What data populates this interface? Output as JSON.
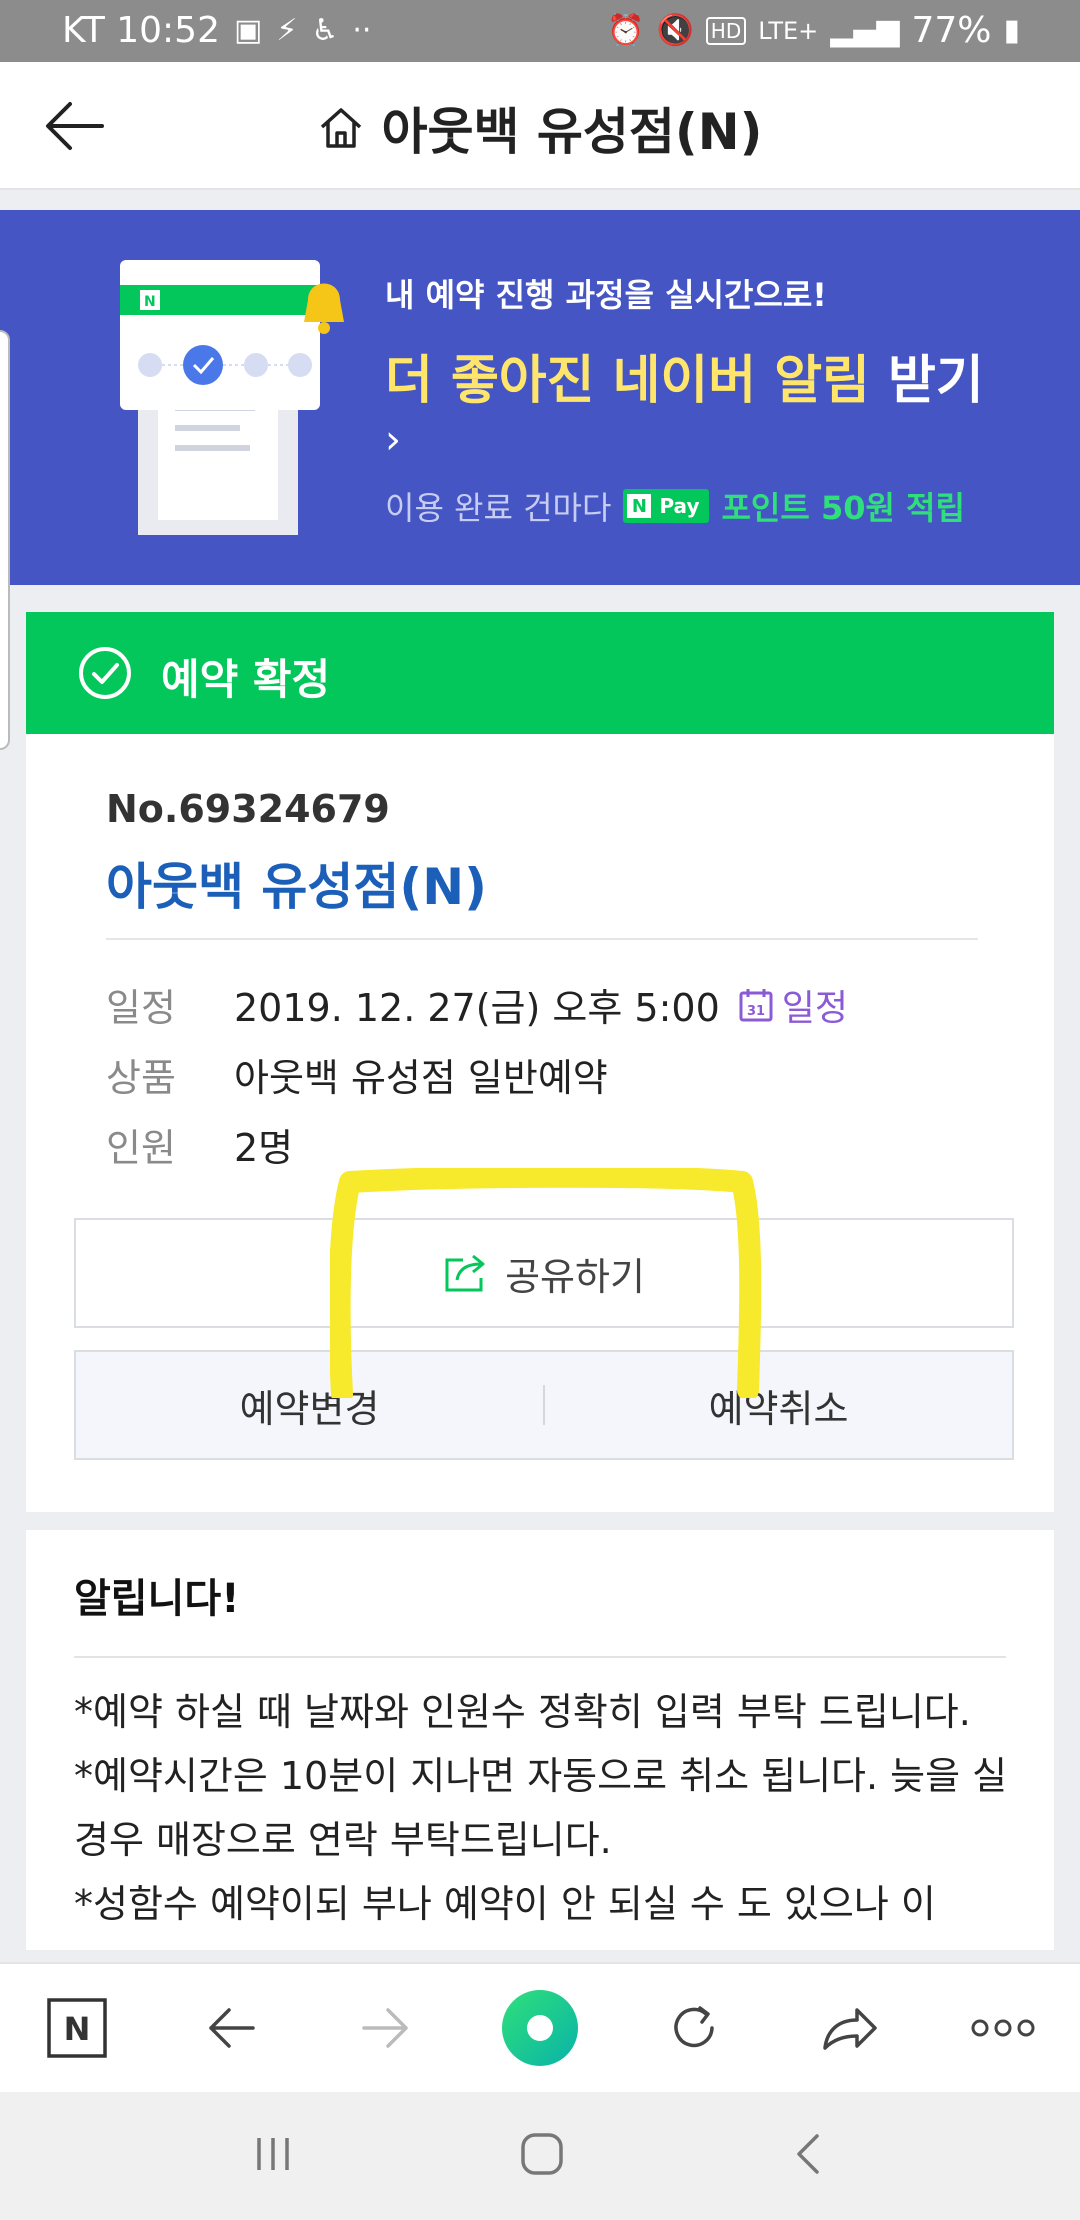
{
  "status_bar": {
    "carrier_time": "KT 10:52",
    "network": "LTE+",
    "battery": "77%"
  },
  "header": {
    "title": "아웃백 유성점(N)"
  },
  "banner": {
    "line1": "내 예약 진행 과정을 실시간으로!",
    "line2_highlight": "더 좋아진 네이버 알림",
    "line2_rest": " 받기",
    "chevron": "›",
    "pay_prefix": "이용 완료 건마다",
    "npay_n": "N",
    "npay_label": "Pay",
    "pay_reward": "포인트 50원 적립"
  },
  "reservation": {
    "status_label": "예약 확정",
    "number": "No.69324679",
    "shop_name": "아웃백 유성점(N)",
    "rows": [
      {
        "label": "일정",
        "value": "2019. 12. 27(금) 오후 5:00"
      },
      {
        "label": "상품",
        "value": "아웃백 유성점 일반예약"
      },
      {
        "label": "인원",
        "value": "2명"
      }
    ],
    "calendar_link": "일정",
    "calendar_day": "31",
    "share_label": "공유하기",
    "change_label": "예약변경",
    "cancel_label": "예약취소"
  },
  "notice": {
    "title": "알립니다!",
    "lines": [
      "*예약 하실 때 날짜와 인원수 정확히 입력 부탁 드립니다.",
      "*예약시간은 10분이 지나면 자동으로 취소 됩니다. 늦을 실 경우 매장으로 연락 부탁드립니다.",
      "*성함수 예약이되 부나 예약이 안 되실 수 도 있으나 이"
    ]
  },
  "toolbar": {
    "home_icon_letter": "N"
  },
  "colors": {
    "banner_bg": "#4556c4",
    "confirm_green": "#03c75a",
    "shop_blue": "#1c5fb8",
    "highlight_yellow": "#f7e92c",
    "calendar_purple": "#8b5bd6"
  }
}
